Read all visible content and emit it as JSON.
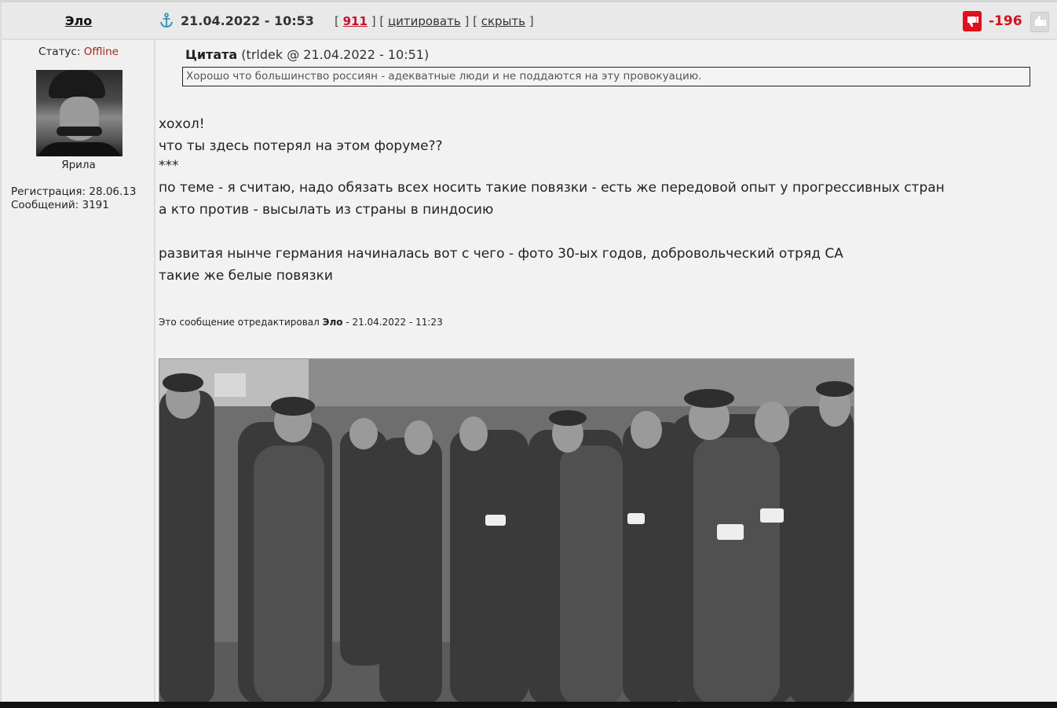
{
  "author": {
    "name": "Эло",
    "status_label": "Статус:",
    "status_value": "Offline",
    "avatar_caption": "Ярила",
    "registration": "Регистрация: 28.06.13",
    "messages": "Сообщений: 3191"
  },
  "header": {
    "anchor_icon": "anchor-icon",
    "date": "21.04.2022 - 10:53",
    "post_number": "911",
    "quote_link": "цитировать",
    "hide_link": "скрыть",
    "rating": "-196",
    "thumb_down_icon": "thumbs-down-icon",
    "thumb_up_icon": "thumbs-up-icon",
    "colors": {
      "rating": "#d4121f",
      "offline": "#a3281c",
      "post_number": "#c8102e"
    }
  },
  "quote": {
    "label": "Цитата",
    "meta": "(trldek @ 21.04.2022 - 10:51)",
    "text": "Хорошо что большинство россиян - адекватные люди и не поддаются на эту провокуацию."
  },
  "body": {
    "lines": [
      "хохол!",
      "что ты здесь потерял на этом форуме??",
      "***",
      "по теме - я считаю, надо обязать всех носить такие повязки - есть же передовой опыт у прогрессивных стран",
      "а кто против - высылать из страны в пиндосию",
      "",
      "развитая нынче германия начиналась вот с чего - фото 30-ых годов, добровольческий отряд СА",
      "такие же белые повязки"
    ]
  },
  "edited": {
    "prefix": "Это сообщение отредактировал",
    "editor": "Эло",
    "suffix": "- 21.04.2022 - 11:23"
  }
}
